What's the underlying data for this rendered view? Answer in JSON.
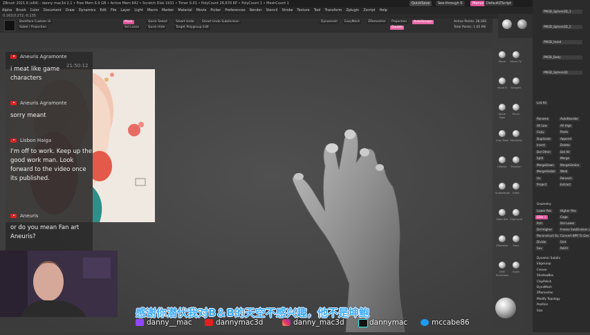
{
  "app": {
    "title_line": "ZBrush 2021.6 (x64) - danny mac3d 2.1 • Free Mem 6.0 GB • Active Mem 642 • Scratch Disk 1931 • Timer 0.01 • PolyCount 26,670 KP • PolyCount 1 • MeshCount 1",
    "quicksave": "QuickSave",
    "see_through": "See-through  0",
    "menus_btn": "Menus",
    "default_script": "DefaultZScript",
    "status_text": "0.163,0.272,-0.135"
  },
  "menubar": [
    "Alpha",
    "Brush",
    "Color",
    "Document",
    "Draw",
    "Dynamics",
    "Edit",
    "File",
    "Layer",
    "Light",
    "Macro",
    "Marker",
    "Material",
    "Movie",
    "Picker",
    "Preferences",
    "Render",
    "Stencil",
    "Stroke",
    "Texture",
    "Tool",
    "Transform",
    "Zplugin",
    "Zscript",
    "Help"
  ],
  "toolbar": {
    "buttons": [
      {
        "label": "Backface Custom Ui"
      },
      {
        "label": "Sobel / Projection"
      },
      {
        "label": "Mask",
        "sel": true
      },
      {
        "label": "Quick Select"
      },
      {
        "label": "Smart Undo"
      },
      {
        "label": "Sel Lasso"
      },
      {
        "label": "Quick Hide"
      },
      {
        "label": "Smart Undo Subdivision"
      },
      {
        "label": "Target Polygroup Edit"
      },
      {
        "label": "Active Points: 26,581"
      },
      {
        "label": "Total Points: 1.65 Mil"
      },
      {
        "label": "Dynamesh"
      },
      {
        "label": "EasyMesh"
      },
      {
        "label": "ZRemesher"
      },
      {
        "label": "Projection"
      },
      {
        "label": "AutoGroups",
        "sel": true
      },
      {
        "label": "Double",
        "sel": true
      }
    ]
  },
  "brushes": [
    {
      "label": "Move"
    },
    {
      "label": "Move Tp"
    },
    {
      "label": "Move E"
    },
    {
      "label": "Smooth"
    },
    {
      "label": "Move Topo"
    },
    {
      "label": "Pinch"
    },
    {
      "label": "Clay Tube"
    },
    {
      "label": "Standard"
    },
    {
      "label": "hPolish"
    },
    {
      "label": "TrimDyn"
    },
    {
      "label": "SnakeHook"
    },
    {
      "label": "Inflat"
    },
    {
      "label": "Dam Std"
    },
    {
      "label": "ClipCurve"
    },
    {
      "label": "ZModeler"
    },
    {
      "label": "Slice"
    },
    {
      "label": "IMM Primitives"
    },
    {
      "label": "Knife"
    }
  ],
  "right_panel": {
    "subtool_items": [
      "PM3D_Sphere3D_1",
      "PM3D_Sphere3D_2",
      "PM3D_Hand",
      "PM3D_Body",
      "PM3D_Sphere3D"
    ],
    "list_all": "List All",
    "actions": [
      "Rename",
      "AutoReorder",
      "All Low",
      "All High",
      "Copy",
      "Paste",
      "Duplicate",
      "Append",
      "Insert",
      "Delete",
      "Del Other",
      "Del All",
      "Split",
      "Merge",
      "MergeDown",
      "MergeSimilar",
      "MergeVisible",
      "Weld",
      "Uv",
      "Remesh",
      "Project",
      "Extract"
    ],
    "geometry_header": "Geometry",
    "geometry": [
      "Lower Res",
      "Higher Res",
      "SDiv 1",
      "Cage",
      "Rstr",
      "Del Lower",
      "Del Higher",
      "Freeze SubDivision Levels",
      "Reconstruct Subdiv",
      "Convert BPR To Geo",
      "Divide",
      "Smt",
      "Suv",
      "ReUV"
    ],
    "geo_sections": [
      "Dynamic Subdiv",
      "EdgeLoop",
      "Crease",
      "ShadowBox",
      "ClayPolish",
      "DynaMesh",
      "ZRemesher",
      "Modify Topology",
      "Position",
      "Size"
    ]
  },
  "chat": {
    "time": "21:50:12",
    "messages": [
      {
        "name": "Aneuris Agramonte",
        "text": "i meat like game characters"
      },
      {
        "name": "Aneuris Agramonte",
        "text": "sorry meant"
      },
      {
        "name": "Lisbon Haiga",
        "text": "I'm off to work. Keep up the good work man. Look forward to the video once its published."
      },
      {
        "name": "Aneuris",
        "text": "or do you mean Fan art Aneuris?"
      }
    ]
  },
  "subtitle": "感谢你潜伏我对B＆B的天空不感兴趣，他不是坤鲍",
  "socials": [
    {
      "icon": "twitch-icon",
      "text": "danny__mac"
    },
    {
      "icon": "youtube-icon",
      "text": "dannymac3d"
    },
    {
      "icon": "instagram-icon",
      "text": "danny_mac3d"
    },
    {
      "icon": "tiktok-icon",
      "text": "dannymac"
    },
    {
      "icon": "twitter-icon",
      "text": "mccabe86"
    }
  ],
  "colors": {
    "accent": "#e0539a",
    "subtitle": "#3aaaff",
    "viewport": "#434343"
  }
}
